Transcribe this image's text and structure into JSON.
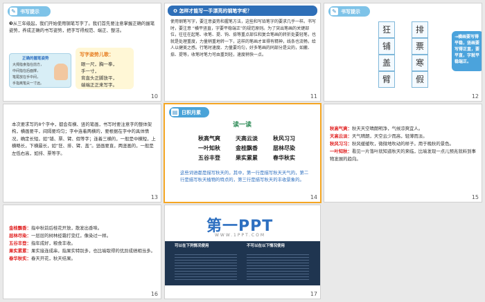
{
  "slides": {
    "s10": {
      "num": "10",
      "header": "书写提示",
      "para": "❸从三年级起，我们开始使用钢笔写字了。我们首先要注意掌握正确的握笔姿势，养成正确的书写姿势，把字写得规范、端正、整洁。",
      "card_title": "正确的握笔姿势",
      "card_lines": [
        "大拇指食指在前方，",
        "中间指在后面撑，",
        "笔尾放在手中间，",
        "手指离笔尖一寸远。"
      ],
      "pose_title": "写字姿势儿歌：",
      "pose_lines": [
        "眼一尺，胸一拳，",
        "手一寸，",
        "背直头正脚放平，",
        "端端正正来写字。"
      ]
    },
    "s11": {
      "num": "11",
      "header": "❹ 怎样才能写一手漂亮的钢笔字呢？",
      "para": "使用钢笔写字，要注意姿势和握笔方法，这些和写铅笔字的要求几乎一样。书写时，要注意 “横平竖直，字要平稳端正”的规范原则。为了突出笔画的关键部位，往往在起笔、收笔、提、钩、捺等重点部位和复合笔画的转折处要轻笔，也就是处理重度，力量稍重地转一下，这样的笔画才显得有精神，线条也流畅，给人以健美之感。行笔时速度、力量要均匀，好多笔画的同部分是尖的，如撇、捺、提等，收笔时笔力可由重到轻，速度稍快一点。"
    },
    "s12": {
      "num": "12",
      "header": "书写提示",
      "chars": [
        "狂",
        "排",
        "",
        "铺",
        "票",
        "",
        "盖",
        "寒",
        "",
        "臂",
        "",
        "假"
      ],
      "bubble": "→横画要写得平稳，竖画要写得正直，要平直，字就平稳端正。"
    },
    "s13": {
      "num": "13",
      "para": "本次要求写的8个字中，都会有横、竖的笔画，书写时要注意字的整体架构，横画要平，间隔要均匀；字中连着两横的，要根据在字中的具体情况，确定长短，如“铺、票、臂、假等字；连着三横的，一般是中横短，上横略长，下横最长，如“狂、排、臂、盖”。竖画要直，两竖画的，一般是左低右高，如排、票等字。"
    },
    "s14": {
      "num": "14",
      "header": "日积月累",
      "title": "读一读",
      "rows": [
        [
          "秋高气爽",
          "天高云淡",
          "秋风习习"
        ],
        [
          "一叶知秋",
          "金桂飘香",
          "层林尽染"
        ],
        [
          "五谷丰登",
          "果实累累",
          "春华秋实"
        ]
      ],
      "note": "这些词语都是描写秋天的，其中，第一行是描写秋天天气的，第二行是描写秋天植物的特点的，第三行是描写秋天的丰收景象的。"
    },
    "s15": {
      "num": "15",
      "items": [
        {
          "term": "秋高气爽：",
          "desc": "秋天天空晴朗明净，气候凉爽宜人。"
        },
        {
          "term": "天高云淡：",
          "desc": "天气晴朗，天空云少而高，轻薄而淡。"
        },
        {
          "term": "秋风习习：",
          "desc": "秋风缓缓吹，微微地吹动的样子。用于晚秋的景色。"
        },
        {
          "term": "一叶知秋：",
          "desc": "看见一片落叶就知道秋天的来临，比喻发现一点儿预兆就料到事物发展的趋向。"
        }
      ]
    },
    "s16": {
      "num": "16",
      "items": [
        {
          "term": "金桂飘香：",
          "desc": "指中秋前后桂花开放，散发出香味。"
        },
        {
          "term": "层林尽染：",
          "desc": "一层层的树林经霜打变红，像染过一样。"
        },
        {
          "term": "五谷丰登：",
          "desc": "指年成好，粮食丰收。"
        },
        {
          "term": "果实累累：",
          "desc": "果实接连成串，指果实特别多，也比喻取得的优异成绩相当多。"
        },
        {
          "term": "春华秋实：",
          "desc": "春天开花，秋天结果。"
        }
      ]
    },
    "s17": {
      "num": "17",
      "logo": "第一PPT",
      "sublogo": "WWW.1PPT.COM",
      "col1_title": "可以在下列情况使用",
      "col2_title": "不可以在以下情况使用"
    }
  }
}
